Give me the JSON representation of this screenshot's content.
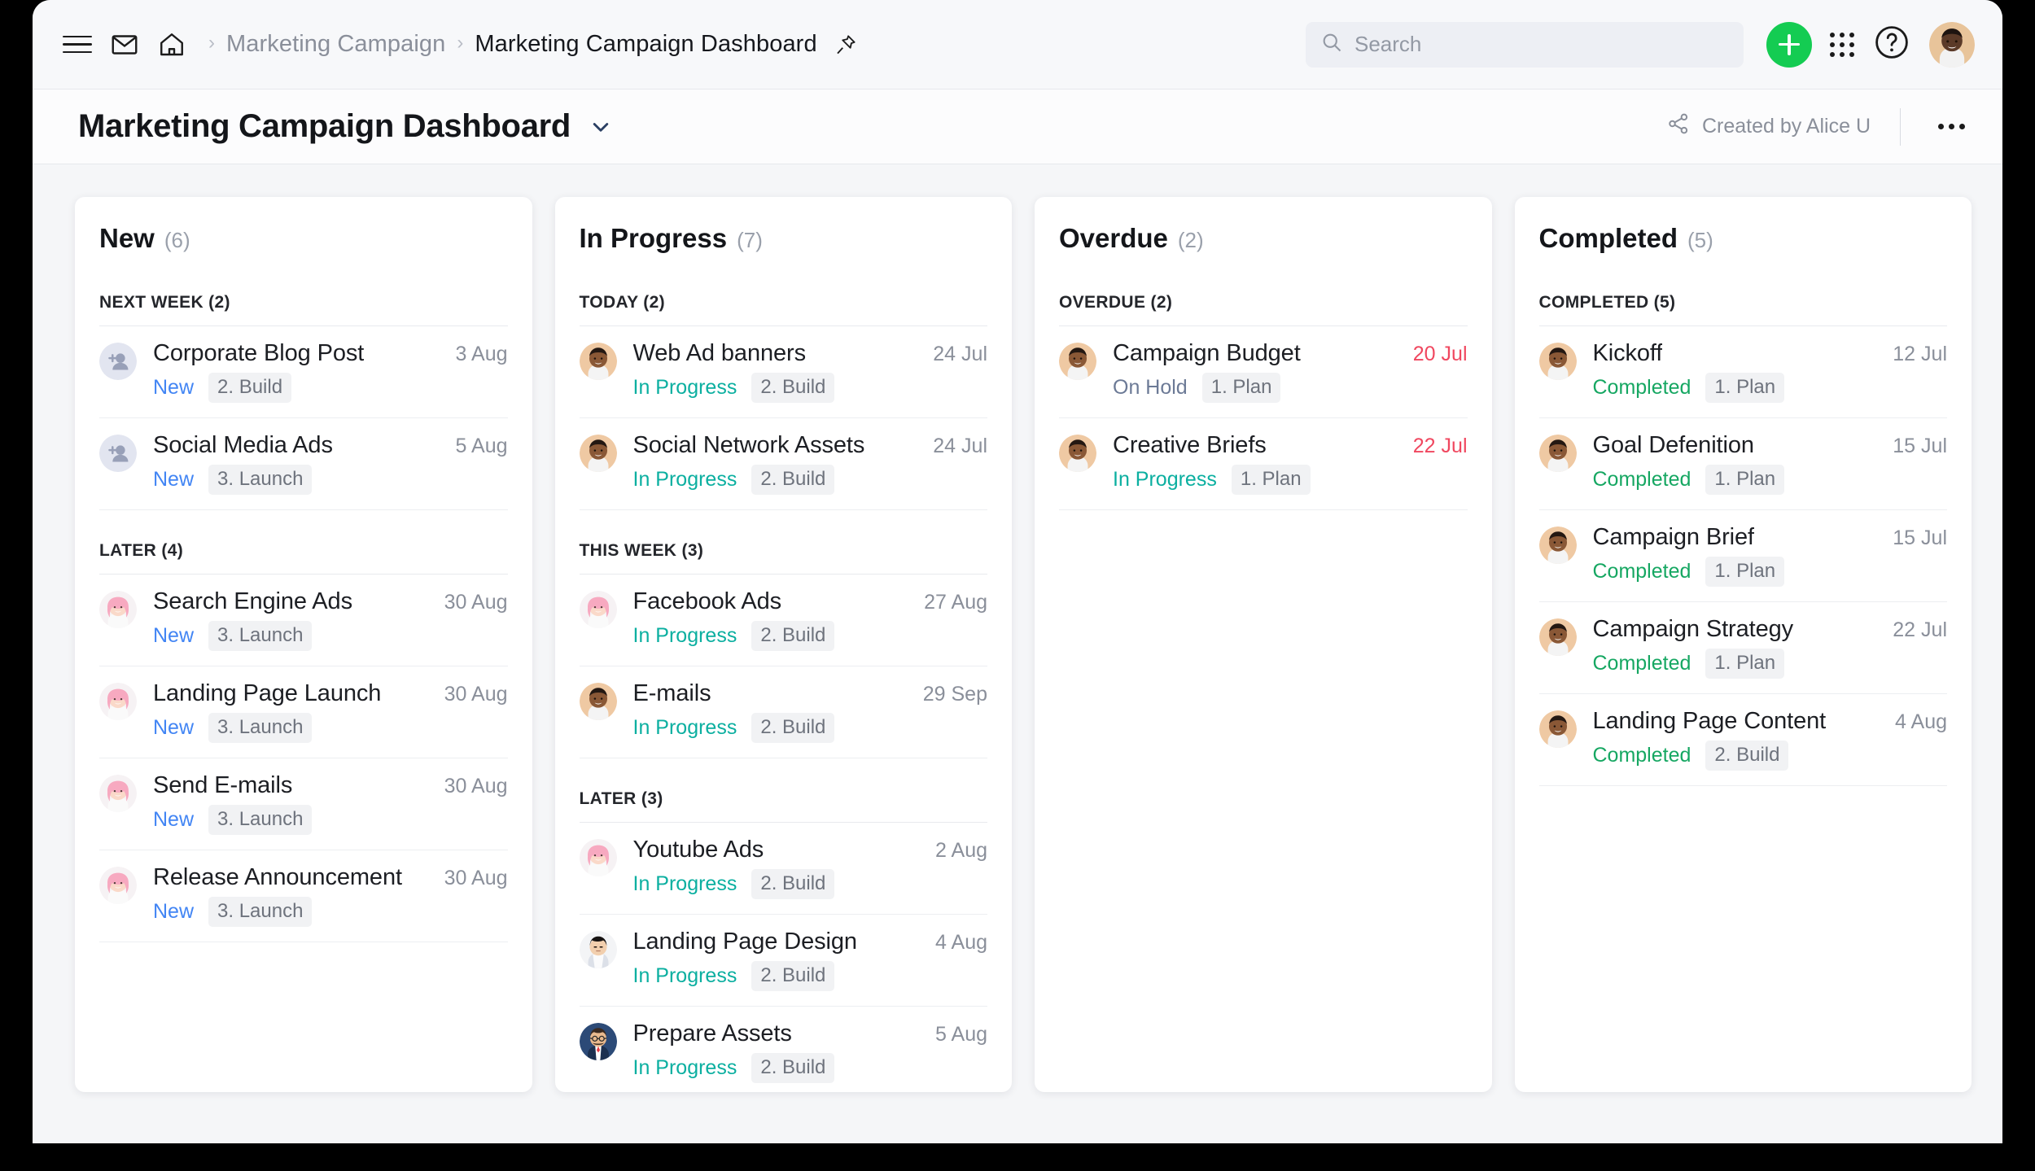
{
  "topbar": {
    "menu_icon": "hamburger-menu-icon",
    "mail_icon": "mail-icon",
    "home_icon": "home-icon",
    "breadcrumb": {
      "parent": "Marketing Campaign",
      "separator": "›",
      "current": "Marketing Campaign Dashboard",
      "pin_icon": "pin-icon"
    },
    "search": {
      "placeholder": "Search",
      "value": "",
      "icon": "search-icon"
    },
    "add_button_icon": "plus-icon",
    "apps_icon": "apps-grid-icon",
    "help_icon": "question-mark-circle-icon",
    "avatar_icon": "user-avatar"
  },
  "titlebar": {
    "title": "Marketing Campaign Dashboard",
    "caret_icon": "chevron-down-icon",
    "share_icon": "share-icon",
    "created_by": "Created by Alice U",
    "more_icon": "more-options-icon"
  },
  "colors": {
    "accent_green": "#14CC52",
    "status_new": "#4285F4",
    "status_in_progress": "#0BAFA0",
    "status_on_hold": "#6C7A96",
    "status_completed": "#16A762",
    "overdue_date": "#F0475F",
    "page_background": "#F5F6F8",
    "card_background": "#FFFFFF"
  },
  "board": {
    "columns": [
      {
        "title": "New",
        "count": "(6)",
        "groups": [
          {
            "label": "NEXT WEEK (2)",
            "tasks": [
              {
                "avatar": "unassigned",
                "name": "Corporate Blog Post",
                "date": "3 Aug",
                "overdue": false,
                "status": "New",
                "status_class": "new",
                "tag": "2. Build"
              },
              {
                "avatar": "unassigned",
                "name": "Social Media Ads",
                "date": "5 Aug",
                "overdue": false,
                "status": "New",
                "status_class": "new",
                "tag": "3. Launch"
              }
            ]
          },
          {
            "label": "LATER (4)",
            "tasks": [
              {
                "avatar": "pink",
                "name": "Search Engine Ads",
                "date": "30 Aug",
                "overdue": false,
                "status": "New",
                "status_class": "new",
                "tag": "3. Launch"
              },
              {
                "avatar": "pink",
                "name": "Landing Page Launch",
                "date": "30 Aug",
                "overdue": false,
                "status": "New",
                "status_class": "new",
                "tag": "3. Launch"
              },
              {
                "avatar": "pink",
                "name": "Send E-mails",
                "date": "30 Aug",
                "overdue": false,
                "status": "New",
                "status_class": "new",
                "tag": "3. Launch"
              },
              {
                "avatar": "pink",
                "name": "Release Announcement",
                "date": "30 Aug",
                "overdue": false,
                "status": "New",
                "status_class": "new",
                "tag": "3. Launch"
              }
            ]
          }
        ]
      },
      {
        "title": "In Progress",
        "count": "(7)",
        "groups": [
          {
            "label": "TODAY (2)",
            "tasks": [
              {
                "avatar": "dark",
                "name": "Web Ad banners",
                "date": "24 Jul",
                "overdue": false,
                "status": "In Progress",
                "status_class": "inprogress",
                "tag": "2. Build"
              },
              {
                "avatar": "dark",
                "name": "Social Network Assets",
                "date": "24 Jul",
                "overdue": false,
                "status": "In Progress",
                "status_class": "inprogress",
                "tag": "2. Build"
              }
            ]
          },
          {
            "label": "THIS WEEK (3)",
            "tasks": [
              {
                "avatar": "pink",
                "name": "Facebook Ads",
                "date": "27 Aug",
                "overdue": false,
                "status": "In Progress",
                "status_class": "inprogress",
                "tag": "2. Build"
              },
              {
                "avatar": "dark",
                "name": "E-mails",
                "date": "29 Sep",
                "overdue": false,
                "status": "In Progress",
                "status_class": "inprogress",
                "tag": "2. Build"
              }
            ]
          },
          {
            "label": "LATER (3)",
            "tasks": [
              {
                "avatar": "pink",
                "name": "Youtube Ads",
                "date": "2 Aug",
                "overdue": false,
                "status": "In Progress",
                "status_class": "inprogress",
                "tag": "2. Build"
              },
              {
                "avatar": "asian",
                "name": "Landing Page Design",
                "date": "4 Aug",
                "overdue": false,
                "status": "In Progress",
                "status_class": "inprogress",
                "tag": "2. Build"
              },
              {
                "avatar": "glasses",
                "name": "Prepare Assets",
                "date": "5 Aug",
                "overdue": false,
                "status": "In Progress",
                "status_class": "inprogress",
                "tag": "2. Build"
              }
            ]
          }
        ]
      },
      {
        "title": "Overdue",
        "count": "(2)",
        "groups": [
          {
            "label": "OVERDUE (2)",
            "tasks": [
              {
                "avatar": "dark",
                "name": "Campaign Budget",
                "date": "20 Jul",
                "overdue": true,
                "status": "On Hold",
                "status_class": "onhold",
                "tag": "1. Plan"
              },
              {
                "avatar": "dark",
                "name": "Creative Briefs",
                "date": "22 Jul",
                "overdue": true,
                "status": "In Progress",
                "status_class": "inprogress",
                "tag": "1. Plan"
              }
            ]
          }
        ]
      },
      {
        "title": "Completed",
        "count": "(5)",
        "groups": [
          {
            "label": "COMPLETED (5)",
            "tasks": [
              {
                "avatar": "dark",
                "name": "Kickoff",
                "date": "12 Jul",
                "overdue": false,
                "status": "Completed",
                "status_class": "completed",
                "tag": "1. Plan"
              },
              {
                "avatar": "dark",
                "name": "Goal Defenition",
                "date": "15 Jul",
                "overdue": false,
                "status": "Completed",
                "status_class": "completed",
                "tag": "1. Plan"
              },
              {
                "avatar": "dark",
                "name": "Campaign Brief",
                "date": "15 Jul",
                "overdue": false,
                "status": "Completed",
                "status_class": "completed",
                "tag": "1. Plan"
              },
              {
                "avatar": "dark",
                "name": "Campaign Strategy",
                "date": "22 Jul",
                "overdue": false,
                "status": "Completed",
                "status_class": "completed",
                "tag": "1. Plan"
              },
              {
                "avatar": "dark",
                "name": "Landing Page Content",
                "date": "4 Aug",
                "overdue": false,
                "status": "Completed",
                "status_class": "completed",
                "tag": "2. Build"
              }
            ]
          }
        ]
      }
    ]
  }
}
